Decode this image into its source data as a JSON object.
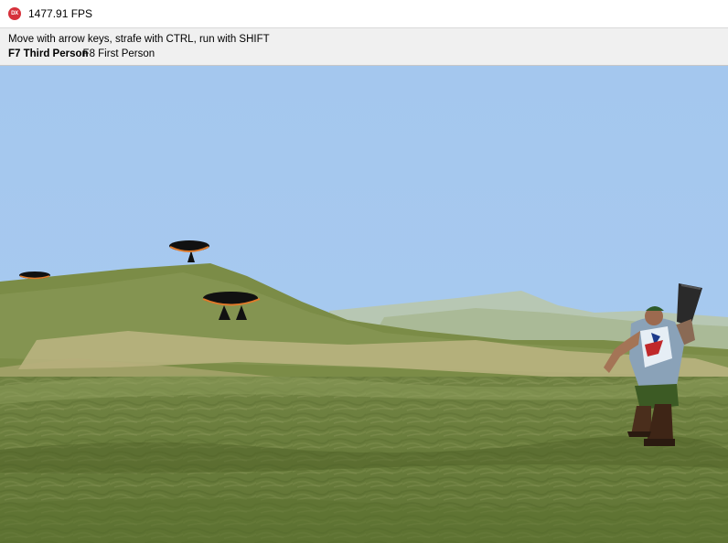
{
  "window": {
    "title": "1477.91 FPS",
    "icon": "dx-icon",
    "icon_text": "DX"
  },
  "hud": {
    "instructions": "Move with arrow keys, strafe with CTRL, run with SHIFT",
    "camera_modes": [
      {
        "label": "F7 Third Person",
        "selected": true
      },
      {
        "label": "F8 First Person",
        "selected": false
      }
    ]
  },
  "scene": {
    "sky_color": "#a7c9ee",
    "objects": [
      "grass-terrain",
      "distant-mountains",
      "mushroom-trees",
      "player-character"
    ]
  }
}
